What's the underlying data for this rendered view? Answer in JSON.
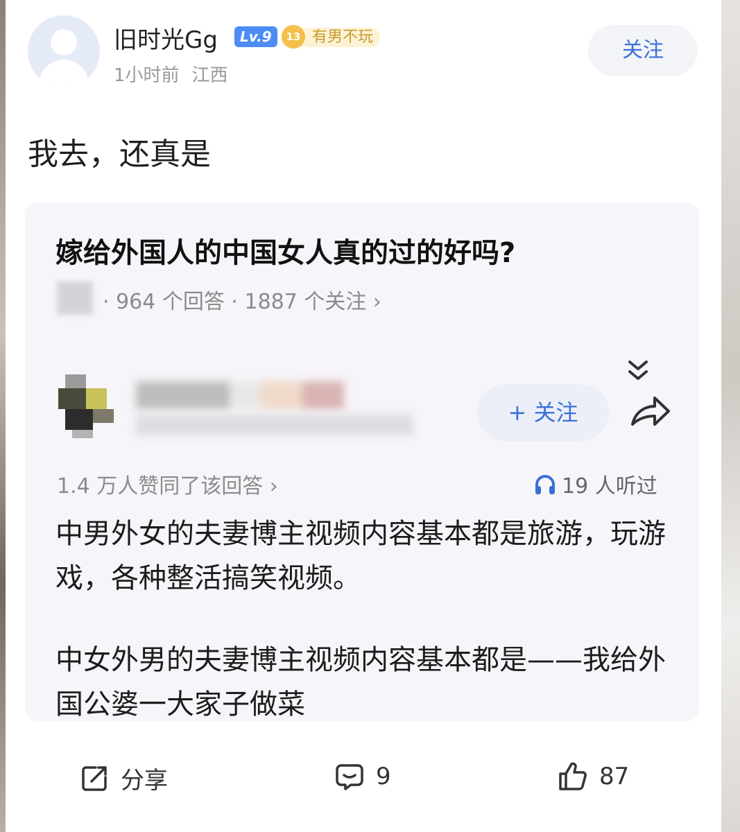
{
  "post": {
    "username": "旧时光Gg",
    "level": "Lv.9",
    "medal_number": "13",
    "medal_title": "有男不玩",
    "time": "1小时前",
    "location": "江西",
    "follow_label": "关注",
    "text": "我去，还真是"
  },
  "quote": {
    "title": "嫁给外国人的中国女人真的过的好吗?",
    "stats": "· 964 个回答 · 1887 个关注  ›",
    "follow_label": "+ 关注",
    "agree_text": "1.4 万人赞同了该回答  ›",
    "listen_text": "19 人听过",
    "paragraph1": "中男外女的夫妻博主视频内容基本都是旅游，玩游戏，各种整活搞笑视频。",
    "paragraph2": "中女外男的夫妻博主视频内容基本都是——我给外国公婆一大家子做菜"
  },
  "actions": {
    "share_label": "分享",
    "comment_count": "9",
    "like_count": "87"
  },
  "icons": [
    "avatar-placeholder",
    "collapse-icon",
    "share-arrow-icon",
    "headphone-icon",
    "share-icon",
    "comment-icon",
    "like-icon"
  ],
  "colors": {
    "accent": "#3a6fd8",
    "level_badge": "#4d8cf5",
    "medal": "#f3c04a"
  }
}
